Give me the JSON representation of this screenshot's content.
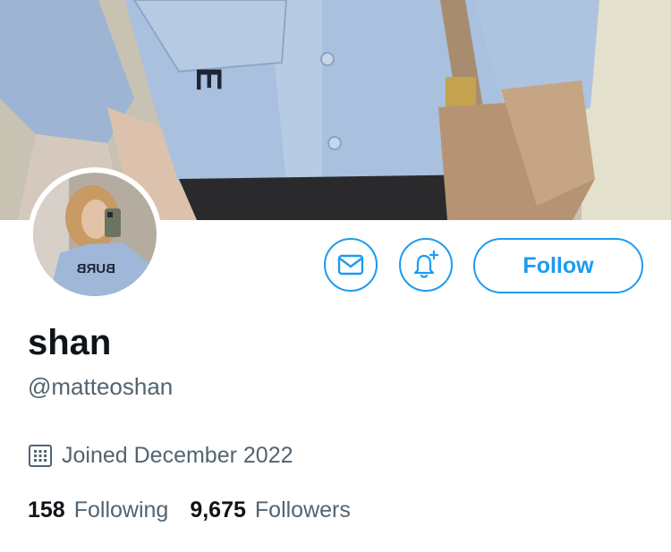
{
  "profile": {
    "display_name": "shan",
    "handle": "@matteoshan",
    "joined": "Joined December 2022",
    "avatar_shirt_text": "BURB"
  },
  "stats": {
    "following_count": "158",
    "following_label": "Following",
    "followers_count": "9,675",
    "followers_label": "Followers"
  },
  "actions": {
    "follow_label": "Follow",
    "message_icon": "envelope-icon",
    "notify_icon": "bell-plus-icon"
  },
  "colors": {
    "accent": "#1d9bf0",
    "text_primary": "#0f1419",
    "text_secondary": "#536471"
  }
}
